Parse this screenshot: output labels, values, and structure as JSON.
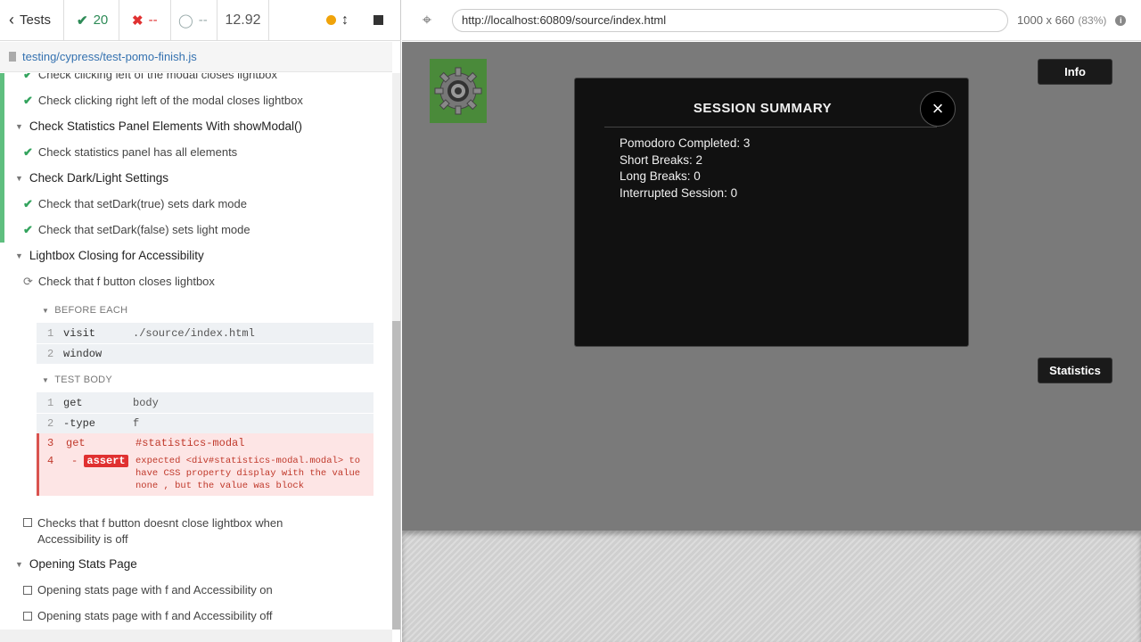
{
  "topbar": {
    "tests_label": "Tests",
    "passed": "20",
    "failed": "--",
    "pending": "--",
    "duration": "12.92"
  },
  "spec_file": "testing/cypress/test-pomo-finish.js",
  "runner": {
    "t1": "Check clicking left of the modal closes lightbox",
    "t2": "Check clicking right left of the modal closes lightbox",
    "s1": "Check Statistics Panel Elements With showModal()",
    "t3": "Check statistics panel has all elements",
    "s2": "Check Dark/Light Settings",
    "t4": "Check that setDark(true) sets dark mode",
    "t5": "Check that setDark(false) sets light mode",
    "s3": "Lightbox Closing for Accessibility",
    "t6": "Check that f button closes lightbox",
    "before_each": "BEFORE EACH",
    "be_cmds": [
      {
        "num": "1",
        "name": "visit",
        "msg": "./source/index.html"
      },
      {
        "num": "2",
        "name": "window",
        "msg": ""
      }
    ],
    "test_body": "TEST BODY",
    "tb_cmds": [
      {
        "num": "1",
        "name": "get",
        "msg": "body"
      },
      {
        "num": "2",
        "name": "-type",
        "msg": "f"
      }
    ],
    "fail_get": {
      "num": "3",
      "name": "get",
      "msg": "#statistics-modal"
    },
    "fail_assert": {
      "num": "4",
      "dash": "-",
      "name": "assert",
      "line1": "expected  <div#statistics-modal.modal>  to",
      "line2": "have CSS property  display  with the value",
      "line3": "none , but the value was  block"
    },
    "t7_line1": "Checks that f button doesnt close lightbox when",
    "t7_line2": "Accessibility is off",
    "s4": "Opening Stats Page",
    "t8": "Opening stats page with f and Accessibility on",
    "t9": "Opening stats page with f and Accessibility off"
  },
  "aut": {
    "url": "http://localhost:60809/source/index.html",
    "viewport": "1000 x 660",
    "scale": "(83%)",
    "info_button": "Info",
    "statistics_button": "Statistics",
    "modal": {
      "title": "SESSION SUMMARY",
      "close": "×",
      "pomodoro": "Pomodoro Completed: 3",
      "short_breaks": "Short Breaks: 2",
      "long_breaks": "Long Breaks: 0",
      "interrupted": "Interrupted Session: 0"
    }
  },
  "icons": [
    "chevron-left-icon",
    "check-icon",
    "x-icon",
    "spinner-icon",
    "status-dot-icon",
    "scroll-arrows-icon",
    "stop-icon",
    "crosshair-icon",
    "info-icon",
    "gear-icon",
    "file-icon"
  ],
  "colors": {
    "pass": "#2e8b57",
    "fail": "#e03131",
    "running_dot": "#f0a30a",
    "modal_bg": "#111111",
    "aut_overlay": "#7a7a7a"
  }
}
